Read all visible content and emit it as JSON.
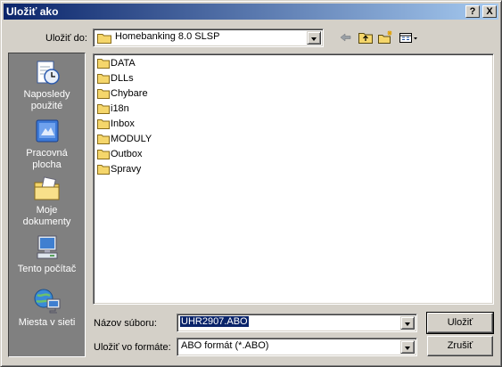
{
  "window": {
    "title": "Uložiť ako",
    "help_button": "?",
    "close_button": "X"
  },
  "location": {
    "label": "Uložiť do:",
    "current": "Homebanking 8.0 SLSP"
  },
  "toolbar": {
    "back": "back-arrow-icon",
    "up": "up-folder-icon",
    "new_folder": "new-folder-icon",
    "view_menu": "view-menu-icon"
  },
  "places": [
    {
      "label_line1": "Naposledy",
      "label_line2": "použité",
      "icon": "recent-icon"
    },
    {
      "label_line1": "Pracovná",
      "label_line2": "plocha",
      "icon": "desktop-icon"
    },
    {
      "label_line1": "Moje",
      "label_line2": "dokumenty",
      "icon": "my-documents-icon"
    },
    {
      "label_line1": "Tento počítač",
      "label_line2": "",
      "icon": "my-computer-icon"
    },
    {
      "label_line1": "Miesta v sieti",
      "label_line2": "",
      "icon": "network-icon"
    }
  ],
  "files": [
    "DATA",
    "DLLs",
    "Chybare",
    "i18n",
    "Inbox",
    "MODULY",
    "Outbox",
    "Spravy"
  ],
  "filename": {
    "label": "Názov súboru:",
    "value": "UHR2907.ABO"
  },
  "filetype": {
    "label": "Uložiť vo formáte:",
    "value": "ABO formát (*.ABO)"
  },
  "buttons": {
    "save": "Uložiť",
    "cancel": "Zrušiť"
  },
  "colors": {
    "title_gradient_start": "#0a246a",
    "title_gradient_end": "#a6caf0",
    "face": "#d4d0c8",
    "places_bar": "#808080",
    "folder": "#f5d66b"
  }
}
